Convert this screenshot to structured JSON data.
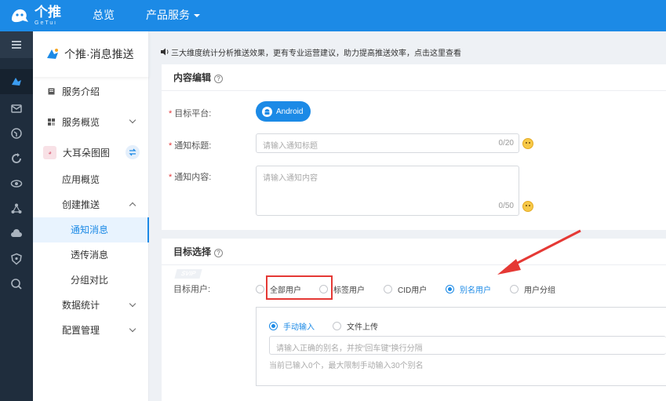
{
  "brand": {
    "name_cn": "个推",
    "name_en": "GeTui"
  },
  "topnav": {
    "overview": "总览",
    "products": "产品服务"
  },
  "sidebar": {
    "title": "个推·消息推送",
    "intro": "服务介绍",
    "overview": "服务概览",
    "app_name": "大耳朵图图",
    "app_overview": "应用概览",
    "create_push": "创建推送",
    "notify_msg": "通知消息",
    "passthrough_msg": "透传消息",
    "ab_test": "分组对比",
    "stats": "数据统计",
    "config": "配置管理"
  },
  "notice": "三大维度统计分析推送效果，更有专业运营建议，助力提高推送效率，点击这里查看",
  "content_section": {
    "title": "内容编辑",
    "platform_label": "目标平台:",
    "platform_button": "Android",
    "title_label": "通知标题:",
    "title_placeholder": "请输入通知标题",
    "title_count": "0/20",
    "body_label": "通知内容:",
    "body_placeholder": "请输入通知内容",
    "body_count": "0/50"
  },
  "target_section": {
    "title": "目标选择",
    "user_label": "目标用户:",
    "options": [
      "全部用户",
      "标签用户",
      "CID用户",
      "别名用户",
      "用户分组"
    ],
    "selected": "别名用户",
    "svip": "SVIP",
    "input_modes": [
      "手动输入",
      "文件上传"
    ],
    "input_mode_selected": "手动输入",
    "alias_placeholder": "请输入正确的别名，并按“回车键”换行分隔",
    "alias_help": "当前已输入0个，最大限制手动输入30个别名"
  },
  "colors": {
    "primary": "#1c8ae6",
    "annotation": "#e53935",
    "rail": "#1f2d3d"
  }
}
